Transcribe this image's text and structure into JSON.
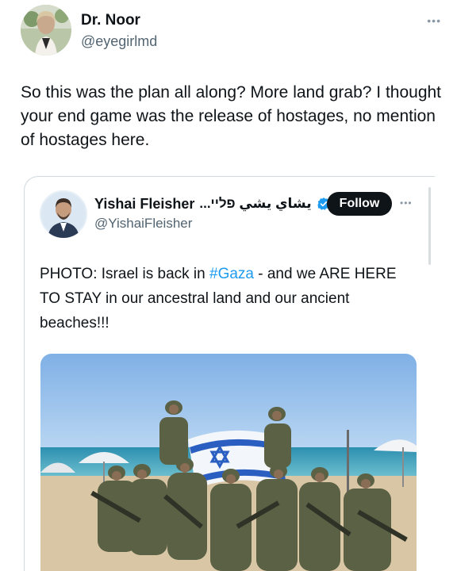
{
  "outer_tweet": {
    "author_name": "Dr. Noor",
    "author_handle": "@eyegirlmd",
    "more_label": "•••",
    "text": "So this was the plan all along? More land grab? I thought your end game was the release of hostages, no mention of hostages here."
  },
  "quoted_tweet": {
    "author_name": "Yishai Fleisher",
    "author_name_rtl": "يشاي يشي פליי...",
    "author_handle": "@YishaiFleisher",
    "follow_label": "Follow",
    "more_label": "•••",
    "text_before": "PHOTO: Israel is back in ",
    "hashtag": "#Gaza",
    "text_after": " - and we ARE HERE TO STAY in our ancestral land and our ancient beaches!!!"
  },
  "colors": {
    "text_primary": "#0f1419",
    "text_secondary": "#536471",
    "link_blue": "#1d9bf0",
    "verified_blue": "#1d9bf0",
    "follow_bg": "#0f1419",
    "border": "#cfd9de"
  },
  "icons": {
    "verified": "verified-badge-icon",
    "more": "more-dots-icon"
  }
}
